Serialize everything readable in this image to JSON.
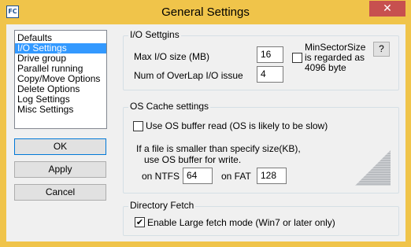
{
  "window": {
    "title": "General Settings",
    "app_icon_text": "FC",
    "close_glyph": "✕"
  },
  "sidebar": {
    "items": [
      {
        "label": "Defaults",
        "selected": false
      },
      {
        "label": "I/O Settings",
        "selected": true
      },
      {
        "label": "Drive group",
        "selected": false
      },
      {
        "label": "Parallel running",
        "selected": false
      },
      {
        "label": "Copy/Move Options",
        "selected": false
      },
      {
        "label": "Delete Options",
        "selected": false
      },
      {
        "label": "Log Settings",
        "selected": false
      },
      {
        "label": "Misc Settings",
        "selected": false
      }
    ],
    "ok_label": "OK",
    "apply_label": "Apply",
    "cancel_label": "Cancel"
  },
  "io_settings": {
    "group_label": "I/O Settgins",
    "max_io_label": "Max I/O size (MB)",
    "max_io_value": "16",
    "overlap_label": "Num of OverLap I/O issue",
    "overlap_value": "4",
    "min_sector_line1": "MinSectorSize",
    "min_sector_line2": "is regarded as",
    "min_sector_line3": "4096 byte",
    "min_sector_checked": false,
    "help_label": "?"
  },
  "os_cache": {
    "group_label": "OS Cache settings",
    "use_buffer_label": "Use OS buffer read (OS is likely to be slow)",
    "use_buffer_checked": false,
    "note_line1": "If a file is smaller than specify size(KB),",
    "note_line2": "use OS buffer for write.",
    "ntfs_label": "on NTFS",
    "ntfs_value": "64",
    "fat_label": "on FAT",
    "fat_value": "128"
  },
  "directory_fetch": {
    "group_label": "Directory Fetch",
    "large_fetch_label": "Enable Large fetch mode (Win7 or later only)",
    "large_fetch_checked": true,
    "check_glyph": "✔"
  },
  "colors": {
    "frame": "#f0c44a",
    "close": "#c7504f",
    "selection": "#3399ff"
  }
}
